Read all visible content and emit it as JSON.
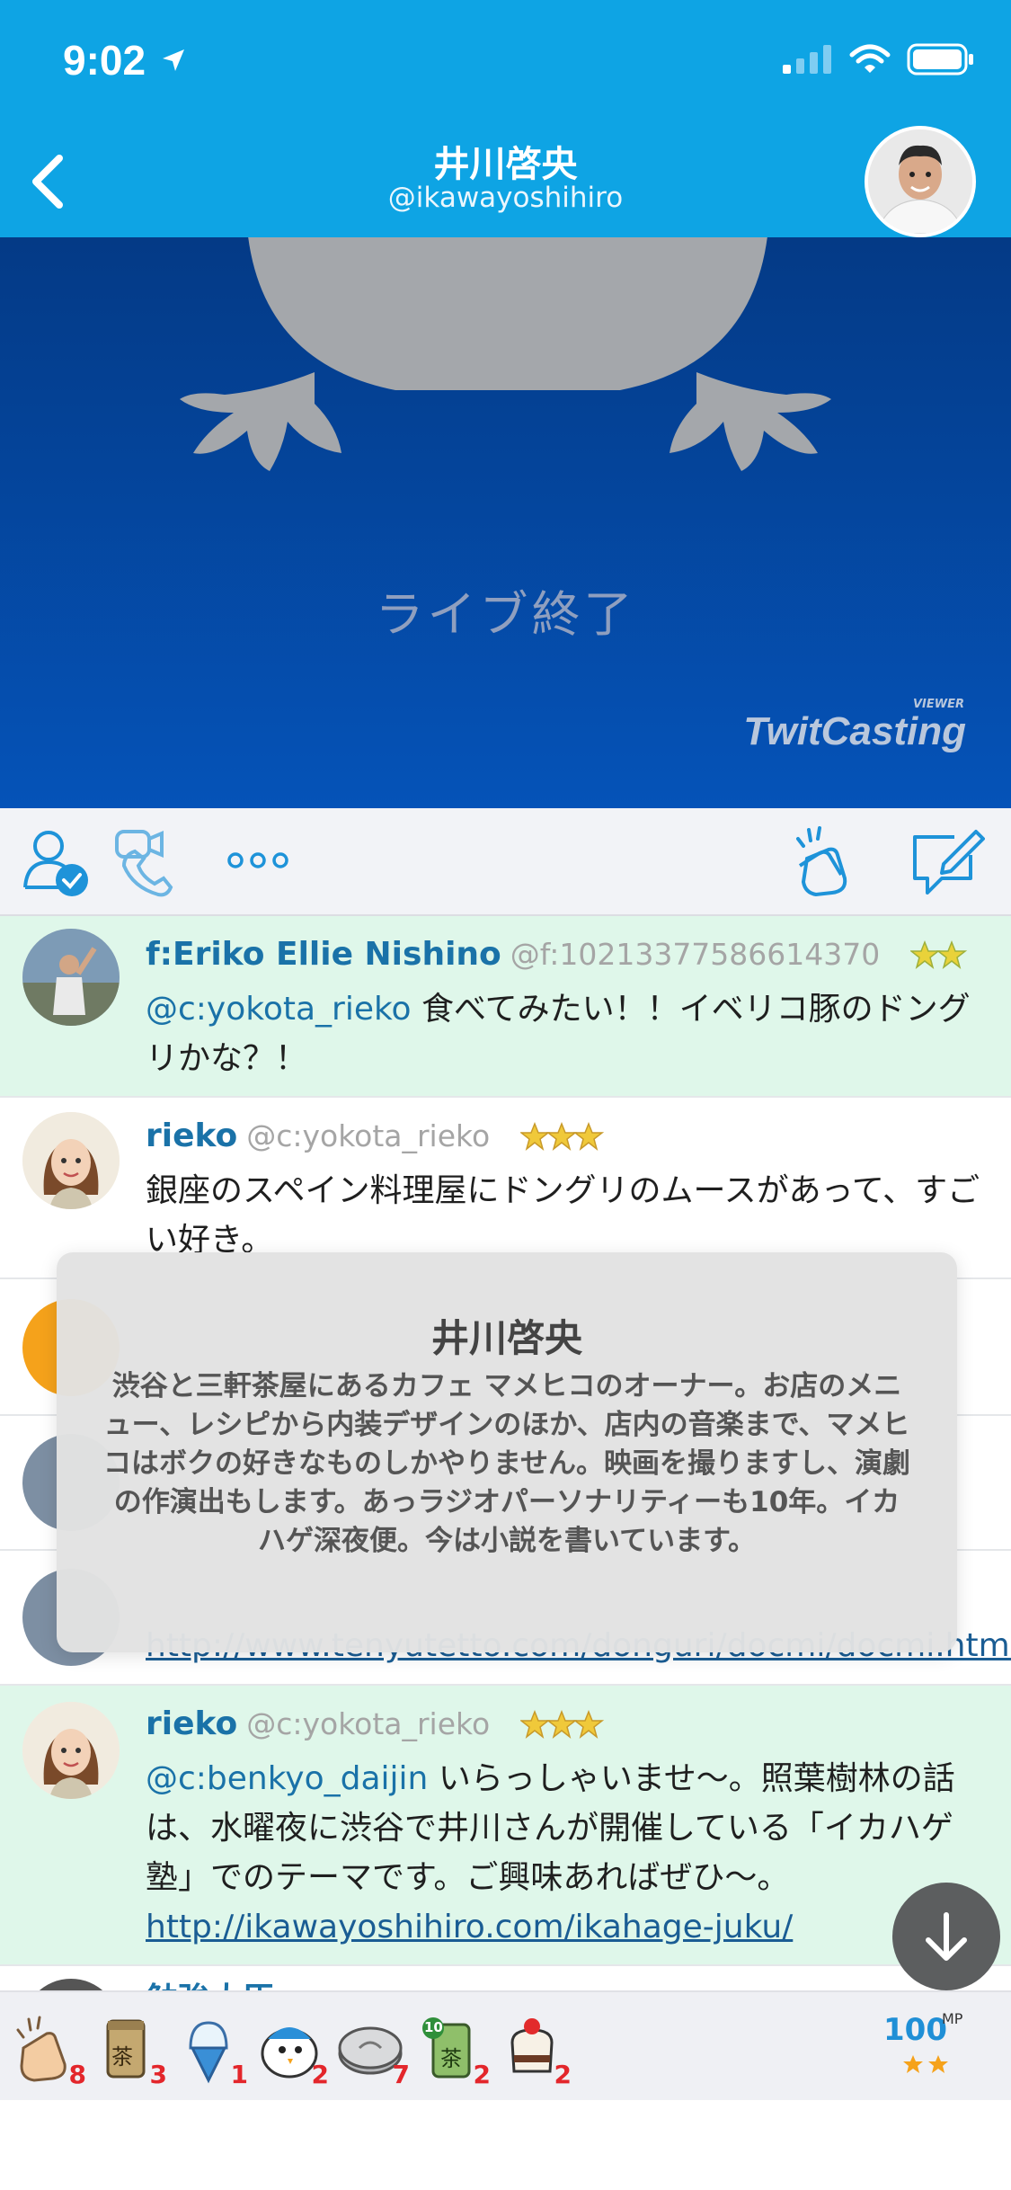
{
  "status": {
    "time": "9:02"
  },
  "header": {
    "title": "井川啓央",
    "handle": "@ikawayoshihiro"
  },
  "video": {
    "status_text": "ライブ終了",
    "logo_text": "TwitCasting",
    "logo_sub": "VIEWER"
  },
  "toolbar": {
    "icons": [
      "follow-check-icon",
      "video-call-icon",
      "more-icon",
      "clap-icon",
      "compose-icon"
    ],
    "more_label": "⋯"
  },
  "comments": [
    {
      "name": "f:Eriko Ellie Nishino",
      "handle": "@f:10213377586614370",
      "stars": 2,
      "mention": "@c:yokota_rieko",
      "text": " 食べてみたい！！イベリコ豚のドングリかな？！",
      "highlighted": true
    },
    {
      "name": "rieko",
      "handle": "@c:yokota_rieko",
      "stars": 3,
      "text": "銀座のスペイン料理屋にドングリのムースがあって、すごい好き。",
      "highlighted": false
    },
    {
      "link": "http://www.tenyutetto.com/donguri/docmi/docmi.html",
      "highlighted": false
    },
    {
      "name": "rieko",
      "handle": "@c:yokota_rieko",
      "stars": 3,
      "mention": "@c:benkyo_daijin",
      "text": " いらっしゃいませ〜。照葉樹林の話は、水曜夜に渋谷で井川さんが開催している「イカハゲ塾」でのテーマです。ご興味あればぜひ〜。",
      "link": "http://ikawayoshihiro.com/ikahage-juku/",
      "highlighted": true
    },
    {
      "name": "勉強大臣",
      "highlighted": false
    }
  ],
  "profile_popup": {
    "name": "井川啓央",
    "bio": "渋谷と三軒茶屋にあるカフェ マメヒコのオーナー。お店のメニュー、レシピから内装デザインのほか、店内の音楽まで、マメヒコはボクの好きなものしかやりません。映画を撮りますし、演劇の作演出もします。あっラジオパーソナリティーも10年。イカハゲ深夜便。今は小説を書いています。"
  },
  "gifts": [
    {
      "icon": "clap-gift-icon",
      "count": "8"
    },
    {
      "icon": "tea-can-gift-icon",
      "count": "3",
      "label": "茶"
    },
    {
      "icon": "ice-cream-gift-icon",
      "count": "1"
    },
    {
      "icon": "bird-gift-icon",
      "count": "2"
    },
    {
      "icon": "coin-gift-icon",
      "count": "7"
    },
    {
      "icon": "tea-10-gift-icon",
      "count": "2",
      "label": "茶",
      "badge": "10"
    },
    {
      "icon": "cake-gift-icon",
      "count": "2"
    }
  ],
  "mp": {
    "value": "100",
    "unit": "MP"
  },
  "colors": {
    "accent": "#0ea4e4",
    "highlight": "#dff7ea",
    "link": "#1a72a8",
    "gift_count": "#e3262b"
  }
}
